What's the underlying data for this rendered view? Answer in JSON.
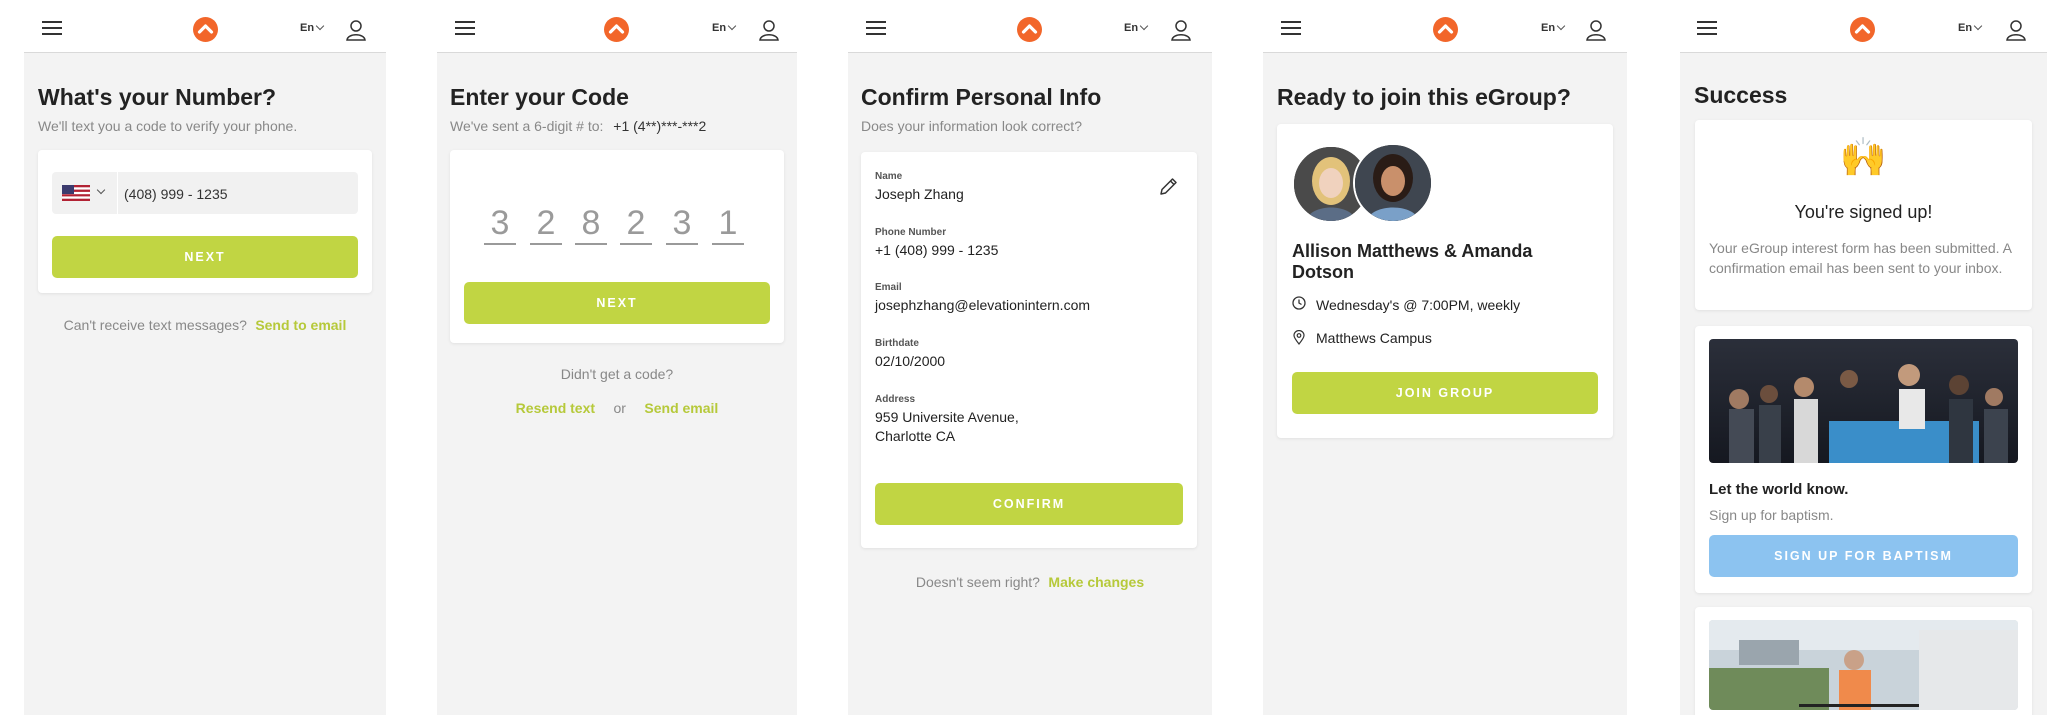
{
  "header": {
    "lang_label": "En"
  },
  "screen1": {
    "title": "What's your Number?",
    "subtitle": "We'll text you a code to verify your phone.",
    "phone_value": "(408) 999 - 1235",
    "next_label": "NEXT",
    "alt_text": "Can't receive text messages?",
    "alt_link": "Send to email"
  },
  "screen2": {
    "title": "Enter your Code",
    "subtitle": "We've sent a 6-digit # to:",
    "masked_number": "+1 (4**)***-***2",
    "digits": [
      "3",
      "2",
      "8",
      "2",
      "3",
      "1"
    ],
    "next_label": "NEXT",
    "no_code_text": "Didn't get a code?",
    "resend_link": "Resend text",
    "or_text": "or",
    "send_email_link": "Send email"
  },
  "screen3": {
    "title": "Confirm Personal Info",
    "subtitle": "Does your information look correct?",
    "fields": [
      {
        "label": "Name",
        "value": "Joseph Zhang"
      },
      {
        "label": "Phone Number",
        "value": "+1 (408) 999 - 1235"
      },
      {
        "label": "Email",
        "value": "josephzhang@elevationintern.com"
      },
      {
        "label": "Birthdate",
        "value": "02/10/2000"
      },
      {
        "label": "Address",
        "value_line1": "959 Universite Avenue,",
        "value_line2": "Charlotte CA"
      }
    ],
    "confirm_label": "CONFIRM",
    "footer_text": "Doesn't seem right?",
    "footer_link": "Make changes"
  },
  "screen4": {
    "title": "Ready to join this eGroup?",
    "leaders_line1": "Allison Matthews & Amanda",
    "leaders_line2": "Dotson",
    "schedule": "Wednesday's @ 7:00PM, weekly",
    "location": "Matthews Campus",
    "join_label": "JOIN GROUP"
  },
  "screen5": {
    "title": "Success",
    "emoji": "🙌",
    "signed_up": "You're signed up!",
    "message": "Your eGroup interest form has been submitted. A confirmation email has been sent to your inbox.",
    "promo_title": "Let the world know.",
    "promo_sub": "Sign up for baptism.",
    "baptism_label": "SIGN UP FOR BAPTISM"
  },
  "colors": {
    "accent_green": "#c1d543",
    "link_green": "#b6c93a",
    "brand_orange": "#f2662a",
    "baptism_blue": "#8cc3f0",
    "background": "#f3f3f3"
  },
  "icons": [
    "menu-icon",
    "logo-icon",
    "chevron-down-icon",
    "user-icon",
    "us-flag-icon",
    "edit-icon",
    "clock-icon",
    "location-pin-icon",
    "raised-hands-emoji"
  ]
}
